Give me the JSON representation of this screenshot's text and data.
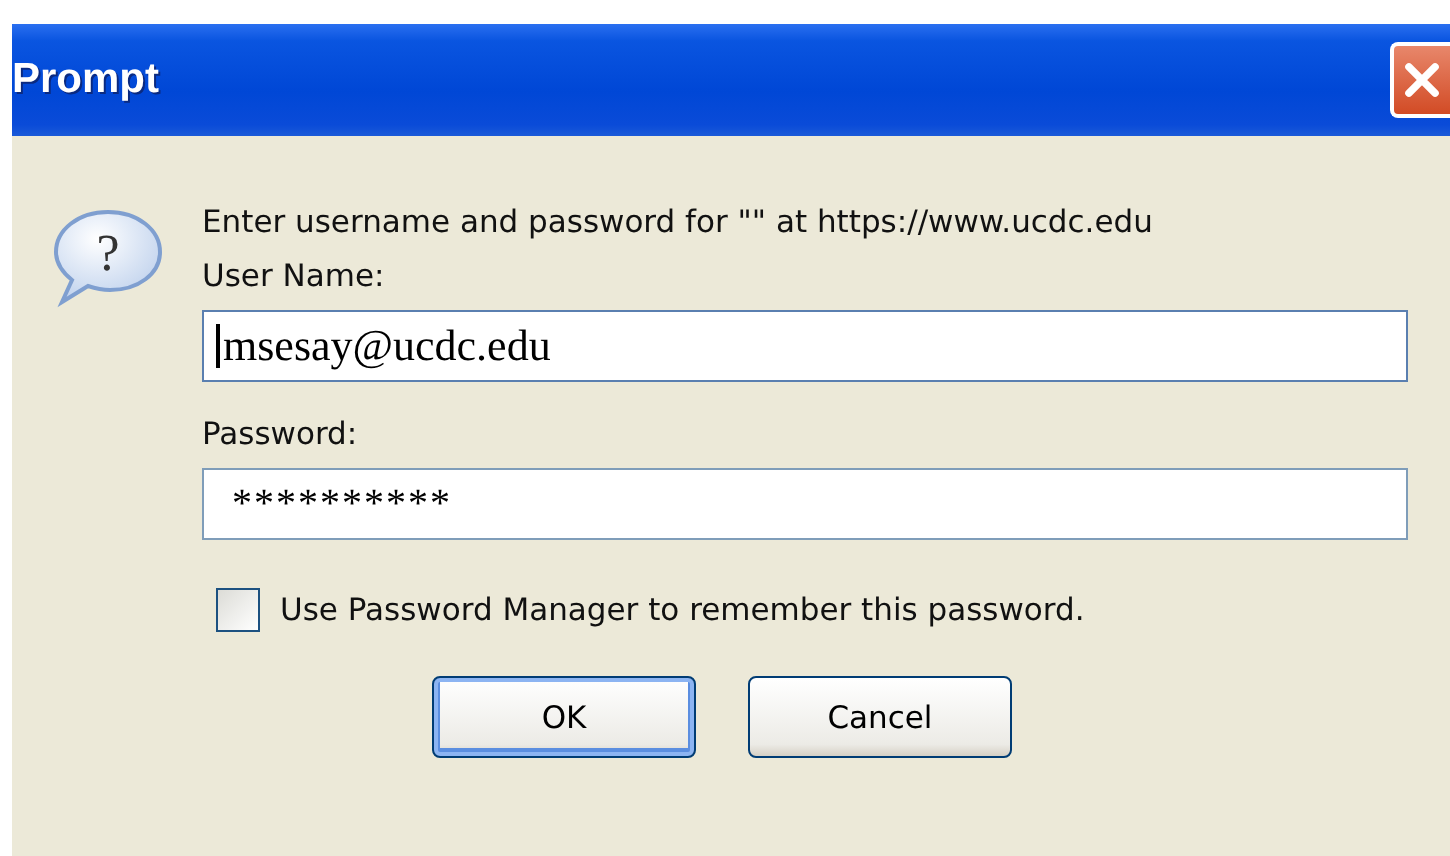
{
  "window": {
    "title": "Prompt"
  },
  "icon_glyph": "?",
  "message": "Enter username and password for \"\" at https://www.ucdc.edu",
  "fields": [
    {
      "label": "User Name:",
      "value": "msesay@ucdc.edu",
      "focused": true
    },
    {
      "label": "Password:",
      "value": "**********",
      "focused": false
    }
  ],
  "checkbox": {
    "label": "Use Password Manager to remember this password.",
    "checked": false
  },
  "buttons": [
    {
      "label": "OK",
      "default": true
    },
    {
      "label": "Cancel",
      "default": false
    }
  ]
}
